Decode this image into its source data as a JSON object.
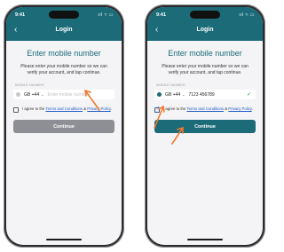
{
  "colors": {
    "brand": "#1b6b79",
    "link": "#1f59c4",
    "disabled": "#8e8f94",
    "success": "#2e8b3a",
    "annotation": "#f07a2c"
  },
  "screens": [
    {
      "status_time": "9:41",
      "status_icons": "ııl ≈ ▭",
      "back_icon": "‹",
      "title": "Login",
      "heading": "Enter mobile number",
      "instructions": "Please enter your mobile number so we can verify your account, and tap continue.",
      "field_label": "MOBILE NUMBER",
      "country": "GB +44",
      "phone_value": "",
      "phone_placeholder": "Enter mobile number",
      "consent_prefix": "I agree to the ",
      "terms_link": "Terms and Conditions",
      "consent_join": " & ",
      "privacy_link": "Privacy Policy",
      "consent_suffix": ".",
      "consent_checked": false,
      "continue_label": "Continue",
      "continue_enabled": false
    },
    {
      "status_time": "9:41",
      "status_icons": "ııl ≈ ▭",
      "back_icon": "‹",
      "title": "Login",
      "heading": "Enter mobile number",
      "instructions": "Please enter your mobile number so we can verify your account, and tap continue.",
      "field_label": "MOBILE NUMBER",
      "country": "GB +44",
      "phone_value": "7123 456789",
      "phone_placeholder": "",
      "consent_prefix": "I agree to the ",
      "terms_link": "Terms and Conditions",
      "consent_join": " & ",
      "privacy_link": "Privacy Policy",
      "consent_suffix": ".",
      "consent_checked": true,
      "continue_label": "Continue",
      "continue_enabled": true
    }
  ]
}
